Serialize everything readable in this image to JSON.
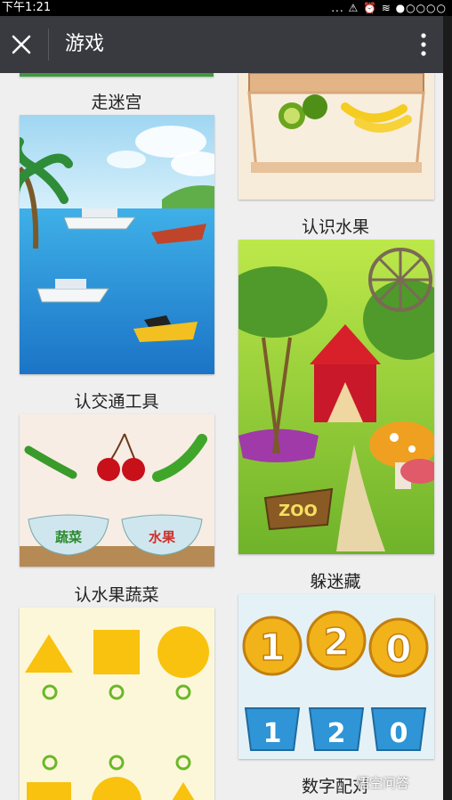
{
  "status_bar": {
    "time": "下午1:21",
    "icons": "... ⚠ ⏰ ≋ ●○○○○"
  },
  "navbar": {
    "title": "游戏"
  },
  "games": {
    "left": [
      {
        "label": "走迷宫"
      },
      {
        "label": "认交通工具"
      },
      {
        "label": "认水果蔬菜"
      }
    ],
    "right": [
      {
        "label": "认识水果"
      },
      {
        "label": "躲迷藏"
      },
      {
        "label": "数字配对"
      }
    ]
  },
  "card_text": {
    "zoo_sign": "ZOO",
    "bowl_vegetable": "蔬菜",
    "bowl_fruit": "水果",
    "digits_top": [
      "1",
      "2",
      "0"
    ],
    "digits_bottom": [
      "1",
      "2",
      "0"
    ]
  },
  "watermark": "悟空问答",
  "colors": {
    "navbar": "#393a3f",
    "background": "#efeff0"
  }
}
